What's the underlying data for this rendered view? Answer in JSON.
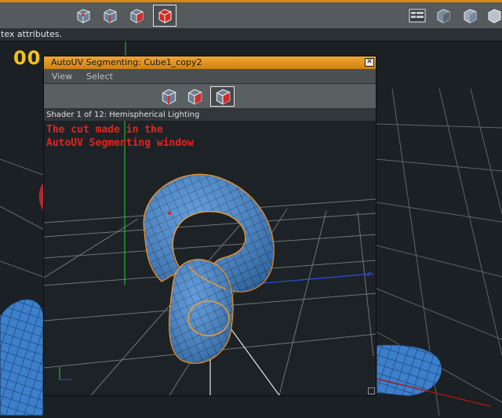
{
  "status": {
    "text": "tex attributes."
  },
  "frame_counter": "00",
  "uv_window": {
    "title": "AutoUV Segmenting: Cube1_copy2",
    "close_symbol": "✕",
    "menu": [
      "View",
      "Select"
    ],
    "shader_label": "Shader  1 of 12: Hemispherical Lighting",
    "annotation": {
      "line1": "The cut made in the",
      "line2": "AutoUV Segmenting window"
    },
    "tools": [
      "cube-edges-icon",
      "cube-faces-icon",
      "cube-selected-face-icon"
    ]
  },
  "top_toolbar": {
    "left_tools": [
      "cube-vertices-icon",
      "cube-edges-icon",
      "cube-faces-icon",
      "cube-object-icon"
    ],
    "right_tools": [
      "display-settings-icon",
      "shaded-cube-icon",
      "solid-cube-icon",
      "wire-cube-icon"
    ]
  },
  "colors": {
    "accent_orange": "#d8890d",
    "mesh_blue": "#3d82d0",
    "cut_orange": "#ff9a1a",
    "annotation_red": "#e8221c"
  }
}
